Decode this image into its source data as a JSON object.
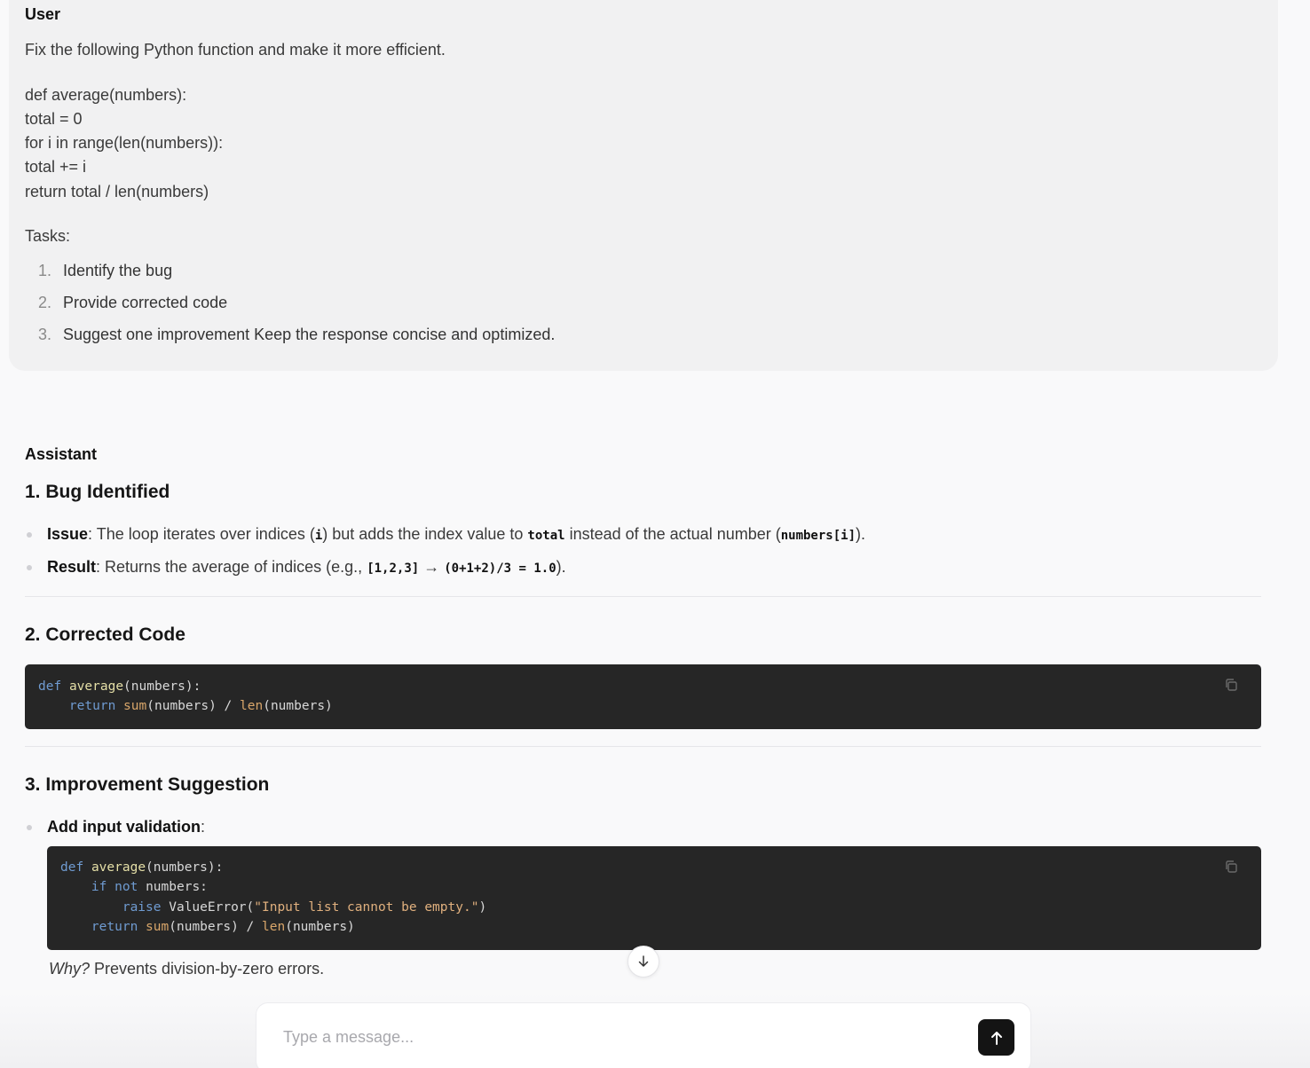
{
  "user": {
    "role": "User",
    "prompt": "Fix the following Python function and make it more efficient.",
    "code_lines": [
      "def average(numbers):",
      "total = 0",
      "for i in range(len(numbers)):",
      "total += i",
      "return total / len(numbers)"
    ],
    "tasks_label": "Tasks:",
    "tasks": [
      {
        "num": "1.",
        "text": "Identify the bug"
      },
      {
        "num": "2.",
        "text": "Provide corrected code"
      },
      {
        "num": "3.",
        "text": "Suggest one improvement Keep the response concise and optimized."
      }
    ]
  },
  "assistant": {
    "role": "Assistant",
    "section1": {
      "heading": "1. Bug Identified",
      "issue_label": "Issue",
      "issue_text_1": ": The loop iterates over indices (",
      "issue_code_1": "i",
      "issue_text_2": ") but adds the index value to ",
      "issue_code_2": "total",
      "issue_text_3": " instead of the actual number (",
      "issue_code_3": "numbers[i]",
      "issue_text_4": ").",
      "result_label": "Result",
      "result_text_1": ": Returns the average of indices (e.g., ",
      "result_code_1": "[1,2,3]",
      "result_arrow": " → ",
      "result_code_2": "(0+1+2)/3 = 1.0",
      "result_text_2": ")."
    },
    "section2": {
      "heading": "2. Corrected Code",
      "code": {
        "l1_kw": "def",
        "l1_fn": "average",
        "l1_rest": "(numbers):",
        "l2_indent": "    ",
        "l2_kw": "return",
        "l2_b1": "sum",
        "l2_mid": "(numbers) / ",
        "l2_b2": "len",
        "l2_end": "(numbers)"
      }
    },
    "section3": {
      "heading": "3. Improvement Suggestion",
      "bullet_label": "Add input validation",
      "bullet_colon": ":",
      "code": {
        "l1_kw": "def",
        "l1_fn": "average",
        "l1_rest": "(numbers):",
        "l2_indent": "    ",
        "l2_kw1": "if",
        "l2_kw2": "not",
        "l2_rest": "numbers:",
        "l3_indent": "        ",
        "l3_kw": "raise",
        "l3_mid": " ValueError(",
        "l3_str": "\"Input list cannot be empty.\"",
        "l3_end": ")",
        "l4_indent": "    ",
        "l4_kw": "return",
        "l4_b1": "sum",
        "l4_mid": "(numbers) / ",
        "l4_b2": "len",
        "l4_end": "(numbers)"
      },
      "why_label": "Why?",
      "why_text": " Prevents division-by-zero errors."
    }
  },
  "composer": {
    "placeholder": "Type a message..."
  },
  "icons": {
    "copy": "copy-icon",
    "scroll_down": "arrow-down-icon",
    "send": "arrow-up-icon"
  },
  "colors": {
    "code_bg": "#262626",
    "keyword": "#6f9bd1",
    "function": "#e5dfa7",
    "builtin": "#d9a66a",
    "send_button": "#141414"
  }
}
